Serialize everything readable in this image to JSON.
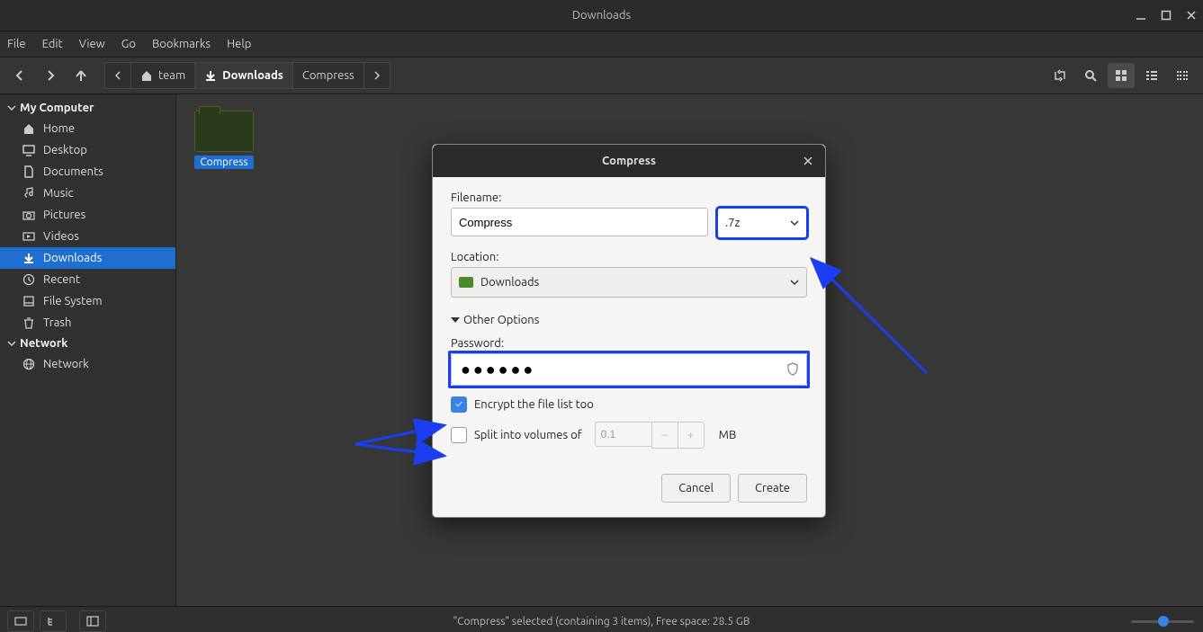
{
  "window": {
    "title": "Downloads"
  },
  "menu": {
    "items": [
      "File",
      "Edit",
      "View",
      "Go",
      "Bookmarks",
      "Help"
    ]
  },
  "path": {
    "root": "team",
    "crumbs": [
      "Downloads",
      "Compress"
    ],
    "active": "Downloads"
  },
  "sidebar": {
    "sections": [
      {
        "title": "My Computer",
        "items": [
          {
            "icon": "home",
            "label": "Home"
          },
          {
            "icon": "desktop",
            "label": "Desktop"
          },
          {
            "icon": "doc",
            "label": "Documents"
          },
          {
            "icon": "music",
            "label": "Music"
          },
          {
            "icon": "pic",
            "label": "Pictures"
          },
          {
            "icon": "vid",
            "label": "Videos"
          },
          {
            "icon": "down",
            "label": "Downloads",
            "active": true
          },
          {
            "icon": "recent",
            "label": "Recent"
          },
          {
            "icon": "fs",
            "label": "File System"
          },
          {
            "icon": "trash",
            "label": "Trash"
          }
        ]
      },
      {
        "title": "Network",
        "items": [
          {
            "icon": "net",
            "label": "Network"
          }
        ]
      }
    ]
  },
  "content": {
    "folder_name": "Compress"
  },
  "dialog": {
    "title": "Compress",
    "filename_label": "Filename:",
    "filename_value": "Compress",
    "ext_value": ".7z",
    "location_label": "Location:",
    "location_value": "Downloads",
    "other_options": "Other Options",
    "password_label": "Password:",
    "password_masked": "●●●●●●",
    "encrypt_label": "Encrypt the file list too",
    "encrypt_checked": true,
    "split_label": "Split into volumes of",
    "split_value": "0.1",
    "split_unit": "MB",
    "cancel": "Cancel",
    "create": "Create"
  },
  "status": {
    "text": "\"Compress\" selected (containing 3 items), Free space: 28.5 GB"
  }
}
